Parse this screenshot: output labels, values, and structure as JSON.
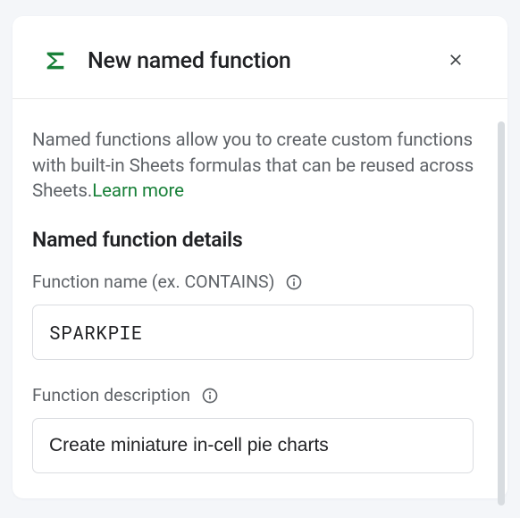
{
  "header": {
    "title": "New named function"
  },
  "body": {
    "description_text": "Named functions allow you to create custom functions with built-in Sheets formulas that can be reused across Sheets.",
    "learn_more_label": "Learn more",
    "section_title": "Named function details",
    "function_name": {
      "label": "Function name (ex. CONTAINS)",
      "value": "SPARKPIE"
    },
    "function_description": {
      "label": "Function description",
      "value": "Create miniature in-cell pie charts"
    }
  }
}
